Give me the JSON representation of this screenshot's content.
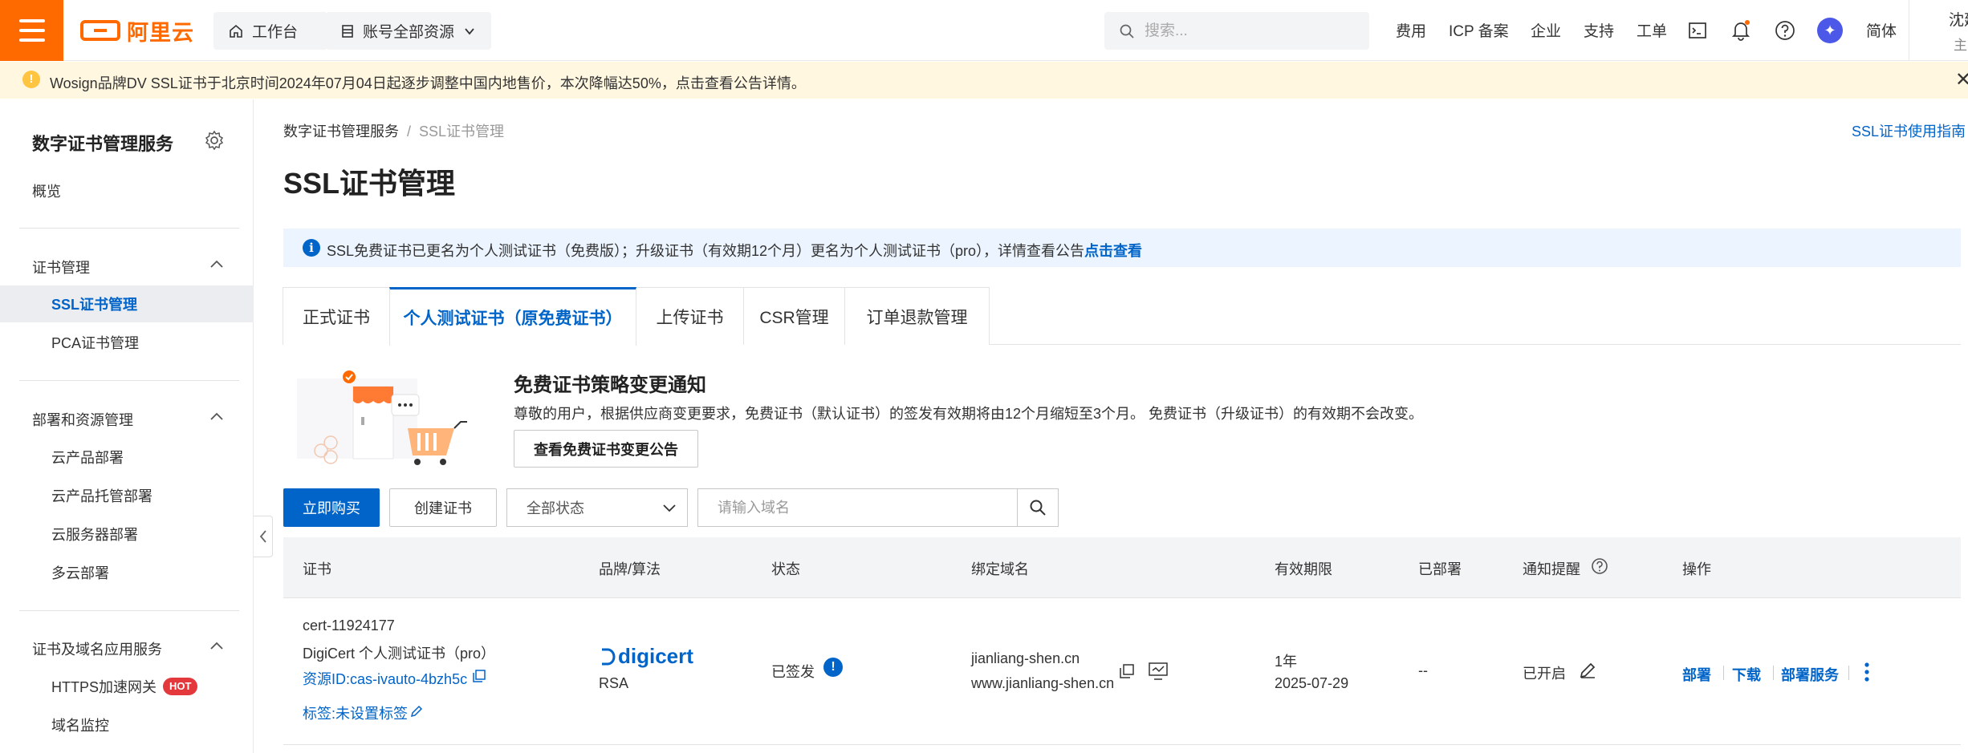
{
  "topbar": {
    "logo_text": "阿里云",
    "workbench": "工作台",
    "account_resources": "账号全部资源",
    "search_placeholder": "搜索...",
    "links": [
      "费用",
      "ICP 备案",
      "企业",
      "支持",
      "工单"
    ],
    "language": "简体",
    "user_name": "沈建",
    "user_sub": "主"
  },
  "banner": {
    "text": "Wosign品牌DV SSL证书于北京时间2024年07月04日起逐步调整中国内地售价，本次降幅达50%，点击查看公告详情。"
  },
  "sidebar": {
    "title": "数字证书管理服务",
    "overview": "概览",
    "groups": [
      {
        "label": "证书管理",
        "items": [
          "SSL证书管理",
          "PCA证书管理"
        ]
      },
      {
        "label": "部署和资源管理",
        "items": [
          "云产品部署",
          "云产品托管部署",
          "云服务器部署",
          "多云部署"
        ]
      },
      {
        "label": "证书及域名应用服务",
        "items": [
          "HTTPS加速网关",
          "域名监控"
        ]
      }
    ],
    "hot_badge": "HOT"
  },
  "breadcrumb": {
    "root": "数字证书管理服务",
    "current": "SSL证书管理"
  },
  "guide_link": "SSL证书使用指南",
  "page_title": "SSL证书管理",
  "info_bar": {
    "text": "SSL免费证书已更名为个人测试证书（免费版）；升级证书（有效期12个月）更名为个人测试证书（pro），详情查看公告",
    "link": "点击查看"
  },
  "tabs": [
    "正式证书",
    "个人测试证书（原免费证书）",
    "上传证书",
    "CSR管理",
    "订单退款管理"
  ],
  "notice": {
    "title": "免费证书策略变更通知",
    "desc": "尊敬的用户，根据供应商变更要求，免费证书（默认证书）的签发有效期将由12个月缩短至3个月。 免费证书（升级证书）的有效期不会改变。",
    "button": "查看免费证书变更公告"
  },
  "toolbar": {
    "buy": "立即购买",
    "create": "创建证书",
    "status": "全部状态",
    "domain_placeholder": "请输入域名"
  },
  "table": {
    "columns": [
      "证书",
      "品牌/算法",
      "状态",
      "绑定域名",
      "有效期限",
      "已部署",
      "通知提醒",
      "操作"
    ],
    "row": {
      "cert_name": "cert-11924177",
      "cert_type": "DigiCert 个人测试证书（pro）",
      "resource_id": "资源ID:cas-ivauto-4bzh5c",
      "tags": "标签:未设置标签",
      "brand": "digicert",
      "algorithm": "RSA",
      "status": "已签发",
      "domains": [
        "jianliang-shen.cn",
        "www.jianliang-shen.cn"
      ],
      "validity": "1年",
      "expire": "2025-07-29",
      "deployed": "--",
      "reminder": "已开启",
      "actions": [
        "部署",
        "下载",
        "部署服务"
      ]
    }
  },
  "colors": {
    "brand_orange": "#ff6a00",
    "primary_blue": "#0064c8",
    "banner_bg": "#fff7e0",
    "info_bg": "#ebf4ff"
  }
}
